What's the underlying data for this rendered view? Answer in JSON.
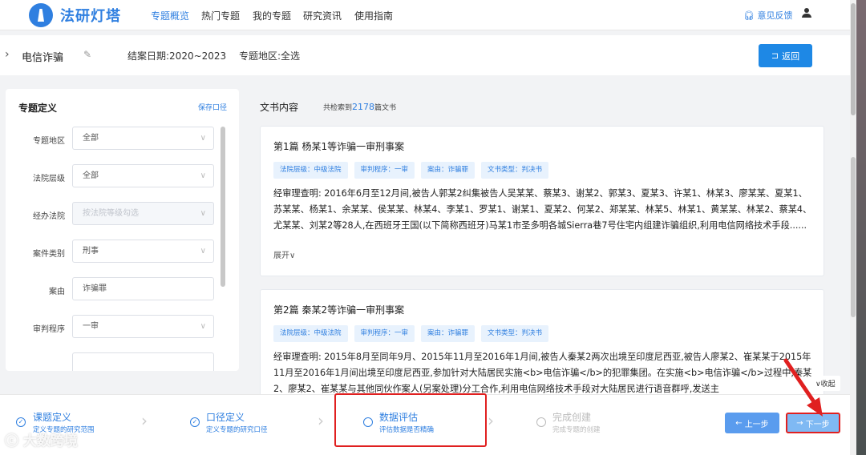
{
  "nav": {
    "logo_text": "法研灯塔",
    "items": [
      "专题概览",
      "热门专题",
      "我的专题",
      "研究资讯",
      "使用指南"
    ],
    "feedback": "意见反馈"
  },
  "subheader": {
    "title": "电信诈骗",
    "date": "结案日期:2020~2023",
    "region": "专题地区:全选",
    "back": "返回"
  },
  "left_panel": {
    "title": "专题定义",
    "save": "保存口径",
    "fields": [
      {
        "label": "专题地区",
        "value": "全部"
      },
      {
        "label": "法院层级",
        "value": "全部"
      },
      {
        "label": "经办法院",
        "value": "按法院等级勾选"
      },
      {
        "label": "案件类别",
        "value": "刑事"
      },
      {
        "label": "案由",
        "value": "诈骗罪"
      },
      {
        "label": "审判程序",
        "value": "一审"
      }
    ]
  },
  "docs": {
    "title": "文书内容",
    "count_prefix": "共检索到",
    "count": "2178",
    "count_suffix": "篇文书",
    "cards": [
      {
        "title": "第1篇 杨某1等诈骗一审刑事案",
        "tags": [
          "法院层级：中级法院",
          "审判程序：一审",
          "案由：诈骗罪",
          "文书类型：判决书"
        ],
        "text": "经审理查明: 2016年6月至12月间,被告人郭某2纠集被告人吴某某、蔡某3、谢某2、郭某3、夏某3、许某1、林某3、廖某某、夏某1、苏某某、杨某1、余某某、侯某某、林某4、李某1、罗某1、谢某1、夏某2、何某2、郑某某、林某5、林某1、黄某某、林某2、蔡某4、尤某某、刘某2等28人,在西班牙王国(以下简称西班牙)马某1市圣多明各城Sierra巷7号住宅内组建诈骗组织,利用电信网络技术手段......",
        "expand": "展开"
      },
      {
        "title": "第2篇 秦某2等诈骗一审刑事案",
        "tags": [
          "法院层级：中级法院",
          "审判程序：一审",
          "案由：诈骗罪",
          "文书类型：判决书"
        ],
        "text": "经审理查明: 2015年8月至同年9月、2015年11月至2016年1月间,被告人秦某2两次出境至印度尼西亚,被告人廖某2、崔某某于2015年11月至2016年1月间出境至印度尼西亚,参加针对大陆居民实施<b>电信诈骗</b>的犯罪集团。在实施<b>电信诈骗</b>过程中,秦某2、廖某2、崔某某与其他同伙作案人(另案处理)分工合作,利用电信网络技术手段对大陆居民进行语音群呼,发送主"
      }
    ]
  },
  "collapse": "收起",
  "steps": [
    {
      "title": "课题定义",
      "sub": "定义专题的研究范围",
      "state": "done"
    },
    {
      "title": "口径定义",
      "sub": "定义专题的研究口径",
      "state": "done"
    },
    {
      "title": "数据评估",
      "sub": "评估数据是否精确",
      "state": "active"
    },
    {
      "title": "完成创建",
      "sub": "完成专题的创建",
      "state": "pending"
    }
  ],
  "buttons": {
    "prev": "上一步",
    "next": "下一步"
  },
  "watermark": "大数跨境",
  "colors": {
    "accent": "#2f7fe0",
    "highlight": "#e02020"
  }
}
